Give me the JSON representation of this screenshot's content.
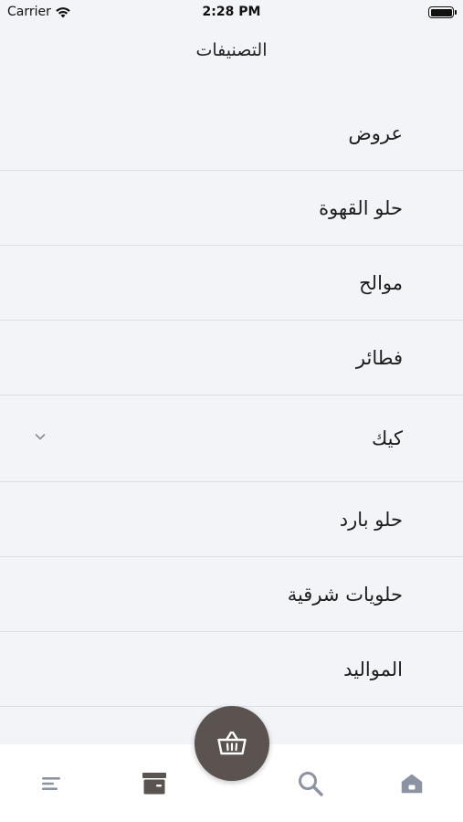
{
  "status_bar": {
    "carrier": "Carrier",
    "time": "2:28 PM"
  },
  "header": {
    "title": "التصنيفات"
  },
  "categories": [
    {
      "label": "عروض",
      "expandable": false
    },
    {
      "label": "حلو القهوة",
      "expandable": false
    },
    {
      "label": "موالح",
      "expandable": false
    },
    {
      "label": "فطائر",
      "expandable": false
    },
    {
      "label": "كيك",
      "expandable": true
    },
    {
      "label": "حلو بارد",
      "expandable": false
    },
    {
      "label": "حلويات شرقية",
      "expandable": false
    },
    {
      "label": "المواليد",
      "expandable": false
    }
  ],
  "tab_bar": {
    "tabs": [
      {
        "icon": "menu-icon"
      },
      {
        "icon": "archive-icon"
      },
      {
        "icon": "search-icon"
      },
      {
        "icon": "home-icon"
      }
    ],
    "fab_icon": "basket-icon"
  },
  "colors": {
    "background": "#f2f4f8",
    "fab": "#5a534f",
    "tab_icon": "#8c93a3",
    "divider": "#dcdee3"
  }
}
